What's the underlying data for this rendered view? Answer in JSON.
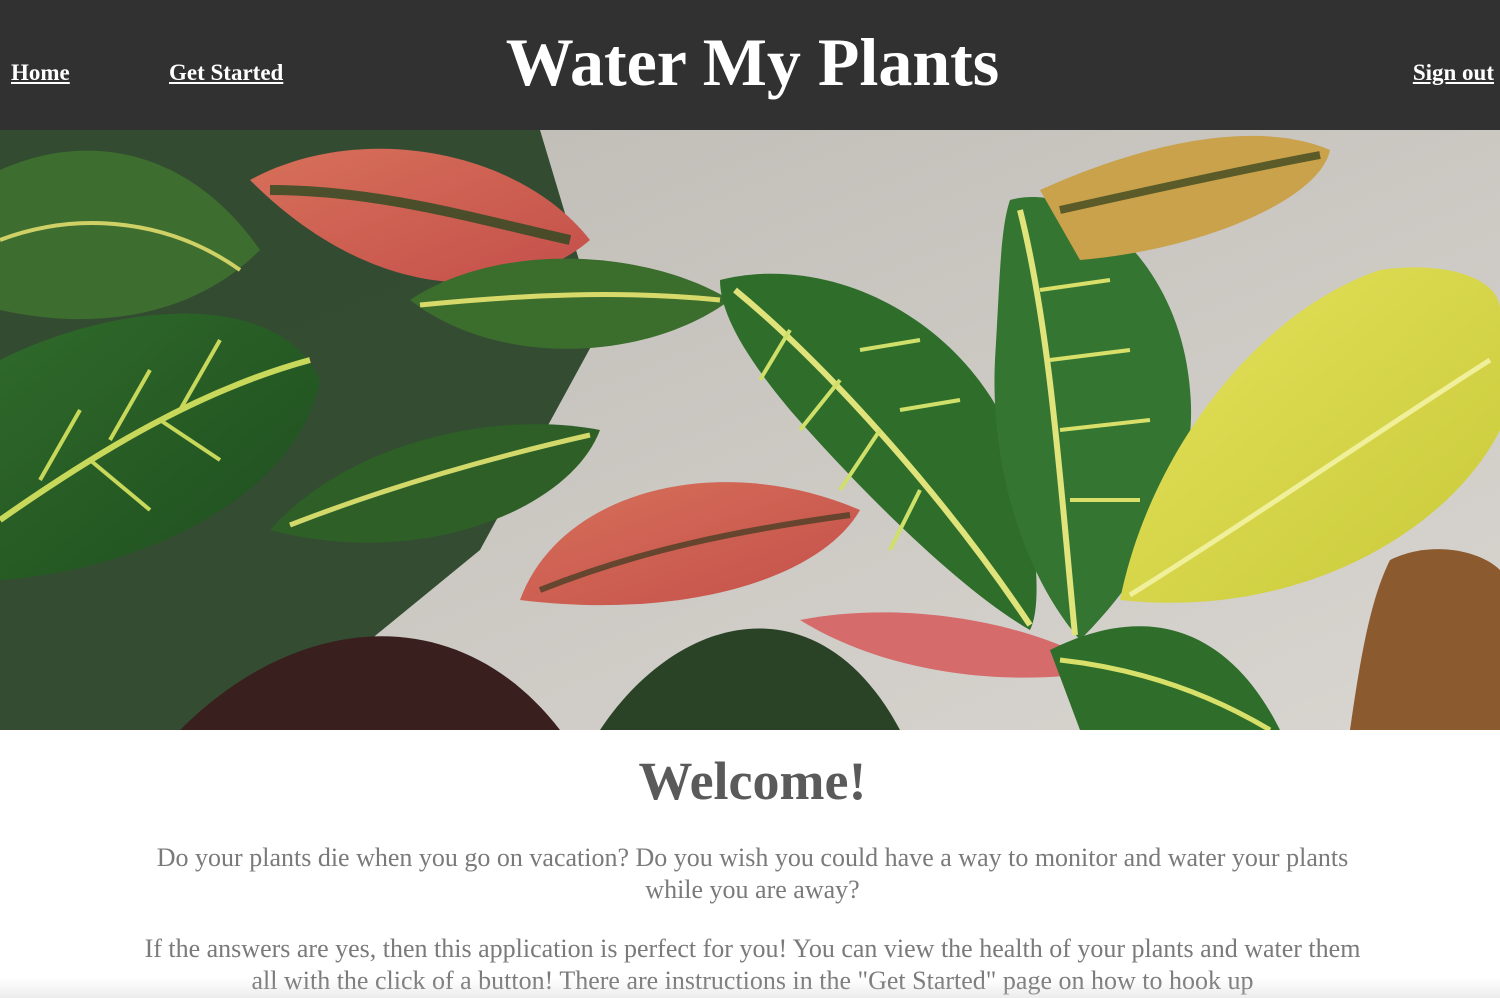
{
  "header": {
    "nav": {
      "home_label": "Home",
      "get_started_label": "Get Started",
      "sign_out_label": "Sign out"
    },
    "title": "Water My Plants"
  },
  "hero": {
    "image_subject": "croton-plant-leaves"
  },
  "main": {
    "heading": "Welcome!",
    "paragraphs": [
      "Do your plants die when you go on vacation? Do you wish you could have a way to monitor and water your plants while you are away?",
      "If the answers are yes, then this application is perfect for you! You can view the health of your plants and water them all with the click of a button! There are instructions in the \"Get Started\" page on how to hook up"
    ]
  },
  "colors": {
    "header_bg": "#313131",
    "header_text": "#ffffff",
    "heading_text": "#5a5a5a",
    "body_text": "#7a7a7a"
  }
}
